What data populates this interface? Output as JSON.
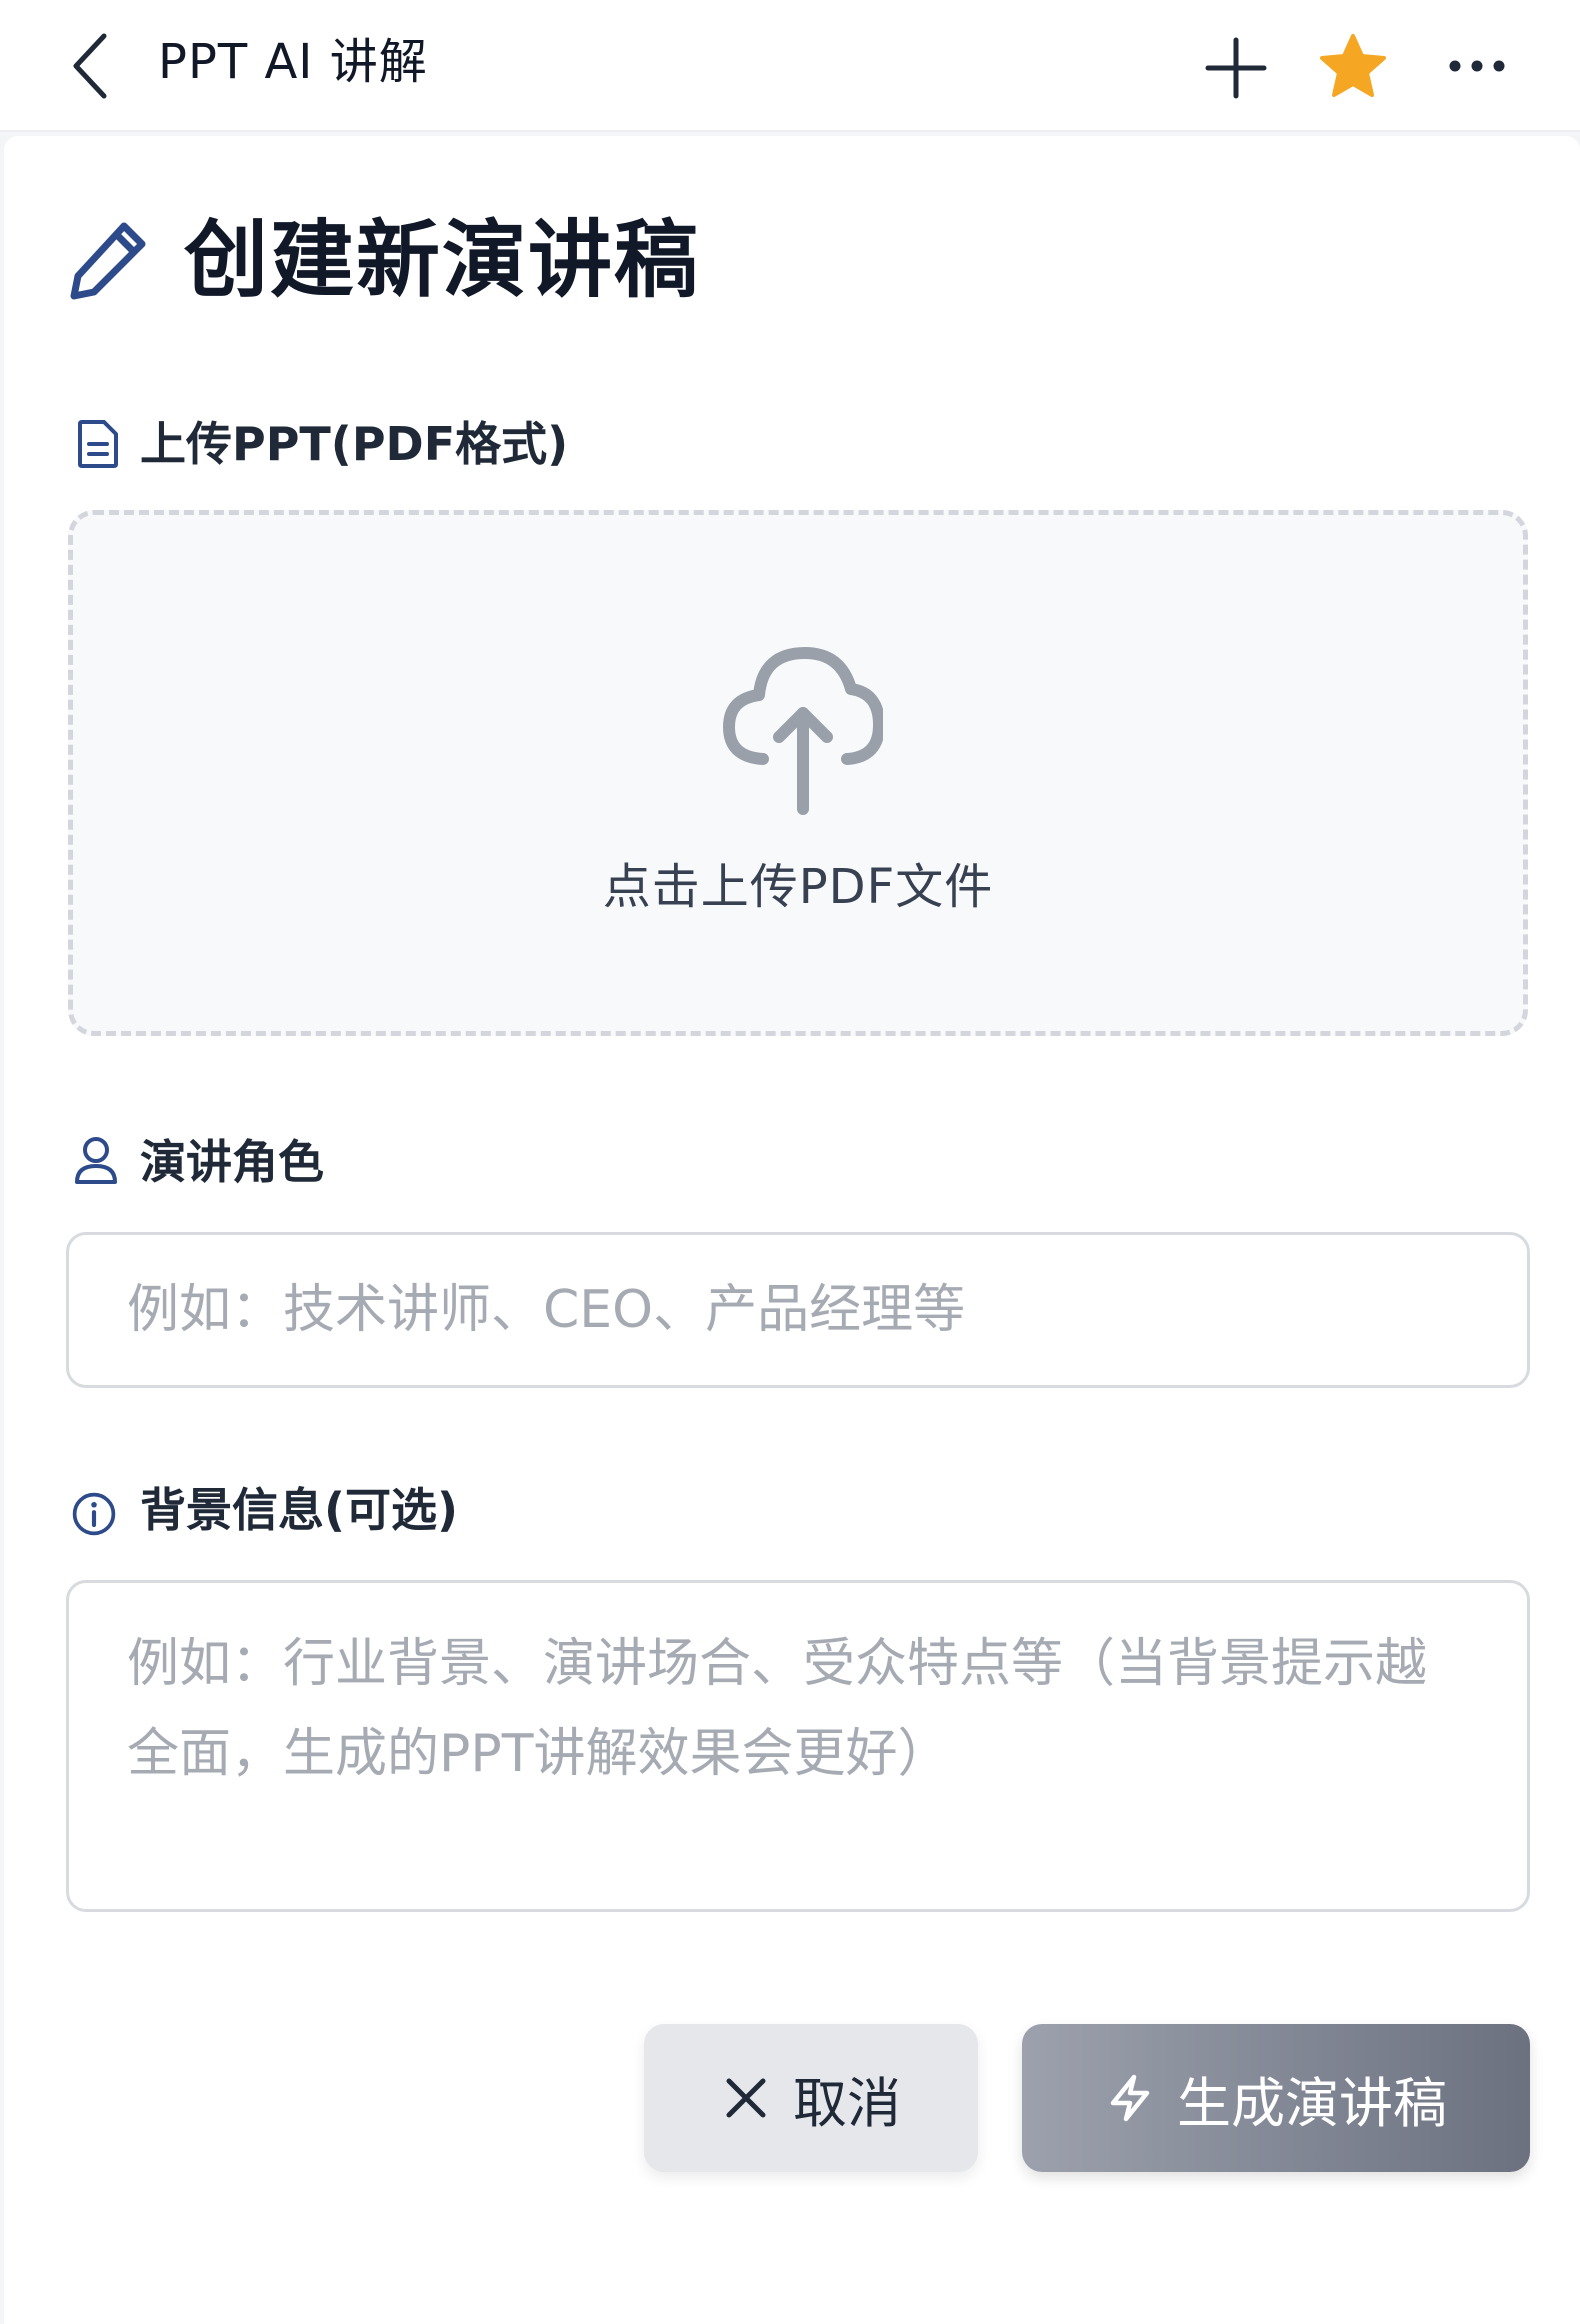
{
  "header": {
    "title": "PPT AI 讲解",
    "icons": {
      "back": "chevron-left-icon",
      "add": "plus-icon",
      "favorite": "star-icon",
      "more": "more-icon"
    },
    "star_color": "#f5a623"
  },
  "page": {
    "title": "创建新演讲稿",
    "title_icon": "pencil-icon",
    "accent_color": "#2d4a8a"
  },
  "upload": {
    "label": "上传PPT(PDF格式)",
    "label_icon": "document-icon",
    "dropzone_text": "点击上传PDF文件",
    "dropzone_icon": "cloud-upload-icon"
  },
  "role": {
    "label": "演讲角色",
    "label_icon": "user-icon",
    "placeholder": "例如：技术讲师、CEO、产品经理等",
    "value": ""
  },
  "background": {
    "label": "背景信息(可选)",
    "label_icon": "info-icon",
    "placeholder": "例如：行业背景、演讲场合、受众特点等（当背景提示越全面，生成的PPT讲解效果会更好）",
    "value": ""
  },
  "actions": {
    "cancel_label": "取消",
    "cancel_icon": "close-icon",
    "generate_label": "生成演讲稿",
    "generate_icon": "lightning-icon"
  }
}
